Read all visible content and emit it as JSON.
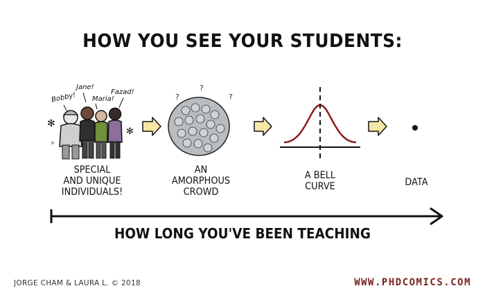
{
  "title": "HOW YOU SEE YOUR STUDENTS:",
  "stages": [
    {
      "lines": [
        "SPECIAL",
        "AND UNIQUE",
        "INDIVIDUALS!"
      ]
    },
    {
      "lines": [
        "AN",
        "AMORPHOUS",
        "CROWD"
      ]
    },
    {
      "lines": [
        "A BELL",
        "CURVE"
      ]
    },
    {
      "lines": [
        "DATA"
      ]
    }
  ],
  "student_names": [
    "Bobby!",
    "Jane!",
    "Maria!",
    "Fazad!"
  ],
  "axis_label": "HOW LONG YOU'VE BEEN TEACHING",
  "credit": "JORGE CHAM & LAURA L. © 2018",
  "url": "WWW.PHDCOMICS.COM",
  "colors": {
    "arrow_fill": "#f6e7a6",
    "curve": "#8b1a1a",
    "url": "#7a2320"
  }
}
